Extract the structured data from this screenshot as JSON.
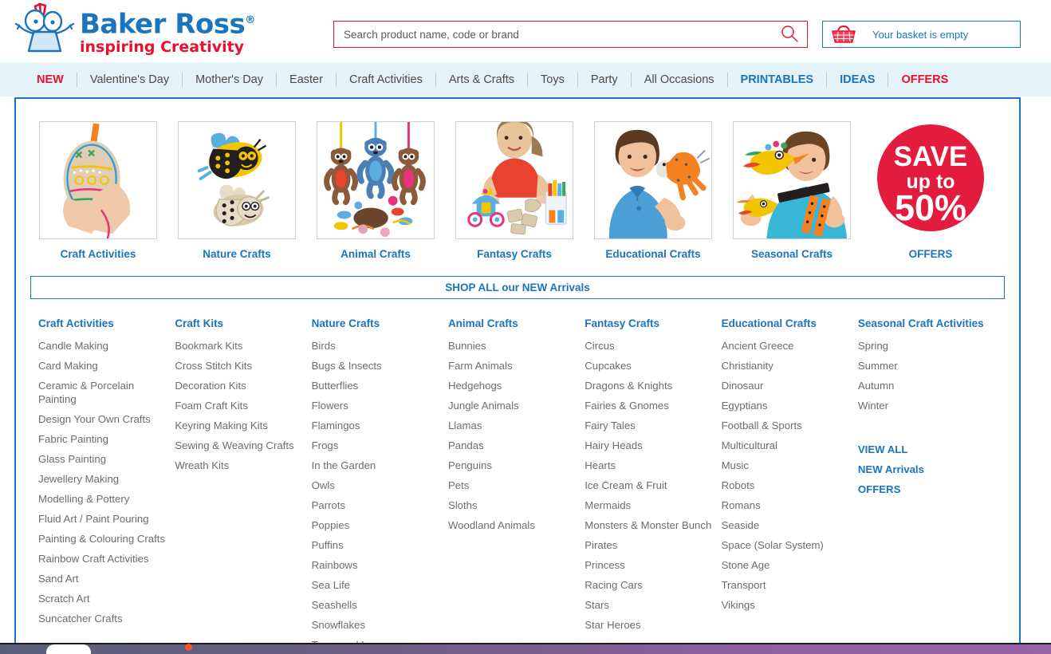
{
  "header": {
    "logo": {
      "title": "Baker Ross",
      "registered": "®",
      "tagline": "inspiring Creativity",
      "mark_icon": "baker-ross-character-logo",
      "brand_blue": "#1b75bc",
      "brand_red": "#e8112d"
    },
    "search": {
      "placeholder": "Search product name, code or brand",
      "value": "",
      "icon": "search-icon"
    },
    "basket": {
      "label": "Your basket is empty",
      "icon": "basket-icon"
    }
  },
  "nav": {
    "items": [
      {
        "label": "NEW",
        "style": "accent-red"
      },
      {
        "label": "Valentine's Day",
        "style": ""
      },
      {
        "label": "Mother's Day",
        "style": ""
      },
      {
        "label": "Easter",
        "style": ""
      },
      {
        "label": "Craft Activities",
        "style": "",
        "active": true
      },
      {
        "label": "Arts & Crafts",
        "style": ""
      },
      {
        "label": "Toys",
        "style": ""
      },
      {
        "label": "Party",
        "style": ""
      },
      {
        "label": "All Occasions",
        "style": ""
      },
      {
        "label": "PRINTABLES",
        "style": "accent-blue"
      },
      {
        "label": "IDEAS",
        "style": "accent-blue"
      },
      {
        "label": "OFFERS",
        "style": "accent-red"
      }
    ]
  },
  "mega": {
    "tiles": [
      {
        "label": "Craft Activities",
        "image": "easter-egg-threading-craft-photo"
      },
      {
        "label": "Nature Crafts",
        "image": "wooden-bee-and-ladybird-craft-photo"
      },
      {
        "label": "Animal Crafts",
        "image": "hanging-sloth-decorations-photo"
      },
      {
        "label": "Fantasy Crafts",
        "image": "girl-making-fairytale-carriage-photo"
      },
      {
        "label": "Educational Crafts",
        "image": "boy-holding-dinosaur-model-photo"
      },
      {
        "label": "Seasonal Crafts",
        "image": "boy-with-bird-puppets-photo"
      },
      {
        "label": "OFFERS",
        "image": "save-up-to-50-percent-badge",
        "badge": {
          "line1": "SAVE",
          "line2": "up to",
          "line3": "50%",
          "color": "#e31c3d"
        }
      }
    ],
    "shop_all": "SHOP ALL our NEW Arrivals",
    "columns": [
      {
        "heading": "Craft Activities",
        "links": [
          "Candle Making",
          "Card Making",
          "Ceramic & Porcelain Painting",
          "Design Your Own Crafts",
          "Fabric Painting",
          "Glass Painting",
          "Jewellery Making",
          "Modelling & Pottery",
          "Fluid Art / Paint Pouring",
          "Painting & Colouring Crafts",
          "Rainbow Craft Activities",
          "Sand Art",
          "Scratch Art",
          "Suncatcher Crafts"
        ]
      },
      {
        "heading": "Craft Kits",
        "links": [
          "Bookmark Kits",
          "Cross Stitch Kits",
          "Decoration Kits",
          "Foam Craft Kits",
          "Keyring Making Kits",
          "Sewing & Weaving Crafts",
          "Wreath Kits"
        ]
      },
      {
        "heading": "Nature Crafts",
        "links": [
          "Birds",
          "Bugs & Insects",
          "Butterflies",
          "Flowers",
          "Flamingos",
          "Frogs",
          "In the Garden",
          "Owls",
          "Parrots",
          "Poppies",
          "Puffins",
          "Rainbows",
          "Sea Life",
          "Seashells",
          "Snowflakes",
          "Trees and Leaves"
        ]
      },
      {
        "heading": "Animal Crafts",
        "links": [
          "Bunnies",
          "Farm Animals",
          "Hedgehogs",
          "Jungle Animals",
          "Llamas",
          "Pandas",
          "Penguins",
          "Pets",
          "Sloths",
          "Woodland Animals"
        ]
      },
      {
        "heading": "Fantasy Crafts",
        "links": [
          "Circus",
          "Cupcakes",
          "Dragons & Knights",
          "Fairies & Gnomes",
          "Fairy Tales",
          "Hairy Heads",
          "Hearts",
          "Ice Cream & Fruit",
          "Mermaids",
          "Monsters & Monster Bunch",
          "Pirates",
          "Princess",
          "Racing Cars",
          "Stars",
          "Star Heroes"
        ]
      },
      {
        "heading": "Educational Crafts",
        "links": [
          "Ancient Greece",
          "Christianity",
          "Dinosaur",
          "Egyptians",
          "Football & Sports",
          "Multicultural",
          "Music",
          "Robots",
          "Romans",
          "Seaside",
          "Space (Solar System)",
          "Stone Age",
          "Transport",
          "Vikings"
        ]
      },
      {
        "heading": "Seasonal Craft Activities",
        "links": [
          "Spring",
          "Summer",
          "Autumn",
          "Winter"
        ],
        "extra": [
          "VIEW ALL",
          "NEW Arrivals",
          "OFFERS"
        ]
      }
    ]
  }
}
